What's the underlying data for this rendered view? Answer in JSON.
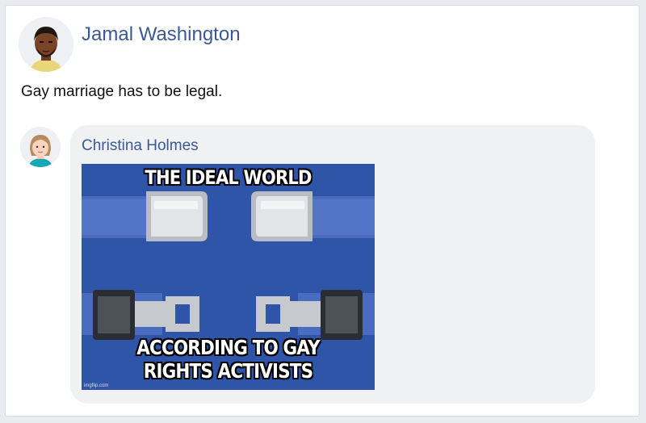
{
  "post": {
    "author": "Jamal Washington",
    "text": "Gay marriage has to be legal."
  },
  "reply": {
    "author": "Christina Holmes",
    "meme": {
      "top_text": "THE IDEAL WORLD",
      "bottom_text_line1": "ACCORDING TO GAY",
      "bottom_text_line2": "RIGHTS ACTIVISTS",
      "watermark": "imgflip.com"
    }
  },
  "colors": {
    "name_link": "#3b5998",
    "bubble_bg": "#f0f1f3",
    "page_bg": "#e9ebee"
  }
}
